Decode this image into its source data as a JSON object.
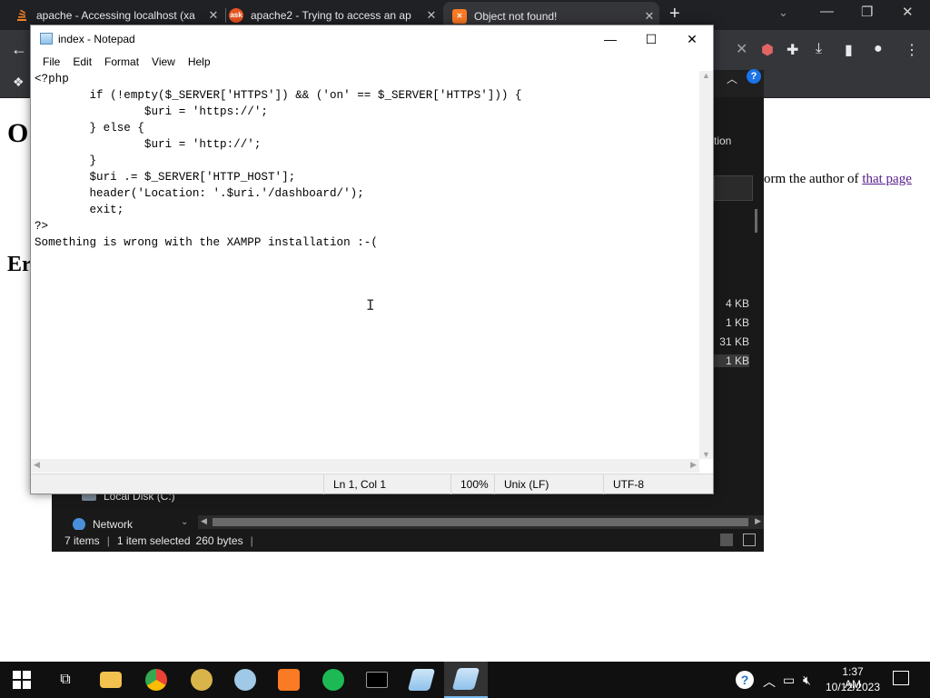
{
  "browser": {
    "tabs": [
      {
        "title": "apache - Accessing localhost (xa",
        "favicon": "stackoverflow-icon",
        "active": false
      },
      {
        "title": "apache2 - Trying to access an ap",
        "favicon": "askubuntu-icon",
        "active": false
      },
      {
        "title": "Object not found!",
        "favicon": "xampp-icon",
        "active": true
      }
    ],
    "new_tab": "+",
    "page": {
      "heading_fragment": "O",
      "text_fragment": "orm the author of ",
      "link_text": "that page",
      "heading2_fragment": "Er"
    }
  },
  "explorer": {
    "ribbon_tab_fragment": "tion",
    "file_sizes": [
      "4 KB",
      "1 KB",
      "31 KB",
      "1 KB"
    ],
    "selected_index": 3,
    "nav_items": [
      "Local Disk (C:)",
      "Network"
    ],
    "status": {
      "items": "7 items",
      "selected": "1 item selected",
      "size": "260 bytes"
    }
  },
  "notepad": {
    "title": "index - Notepad",
    "menu": [
      "File",
      "Edit",
      "Format",
      "View",
      "Help"
    ],
    "content": "<?php\n\tif (!empty($_SERVER['HTTPS']) && ('on' == $_SERVER['HTTPS'])) {\n\t\t$uri = 'https://';\n\t} else {\n\t\t$uri = 'http://';\n\t}\n\t$uri .= $_SERVER['HTTP_HOST'];\n\theader('Location: '.$uri.'/dashboard/');\n\texit;\n?>\nSomething is wrong with the XAMPP installation :-(",
    "status": {
      "position": "Ln 1, Col 1",
      "zoom": "100%",
      "line_ending": "Unix (LF)",
      "encoding": "UTF-8"
    }
  },
  "taskbar": {
    "apps": [
      "file-explorer-icon",
      "chrome-icon",
      "bee-app-icon",
      "anime-app-icon",
      "xampp-icon",
      "green-app-icon",
      "terminal-icon",
      "notepad-icon",
      "notepad-icon"
    ],
    "clock": {
      "time": "1:37 AM",
      "date": "10/12/2023"
    }
  },
  "colors": {
    "chrome_dark": "#202124",
    "chrome_toolbar": "#35363a",
    "explorer_bg": "#191919",
    "taskbar_bg": "#101010",
    "link": "#551a8b"
  }
}
